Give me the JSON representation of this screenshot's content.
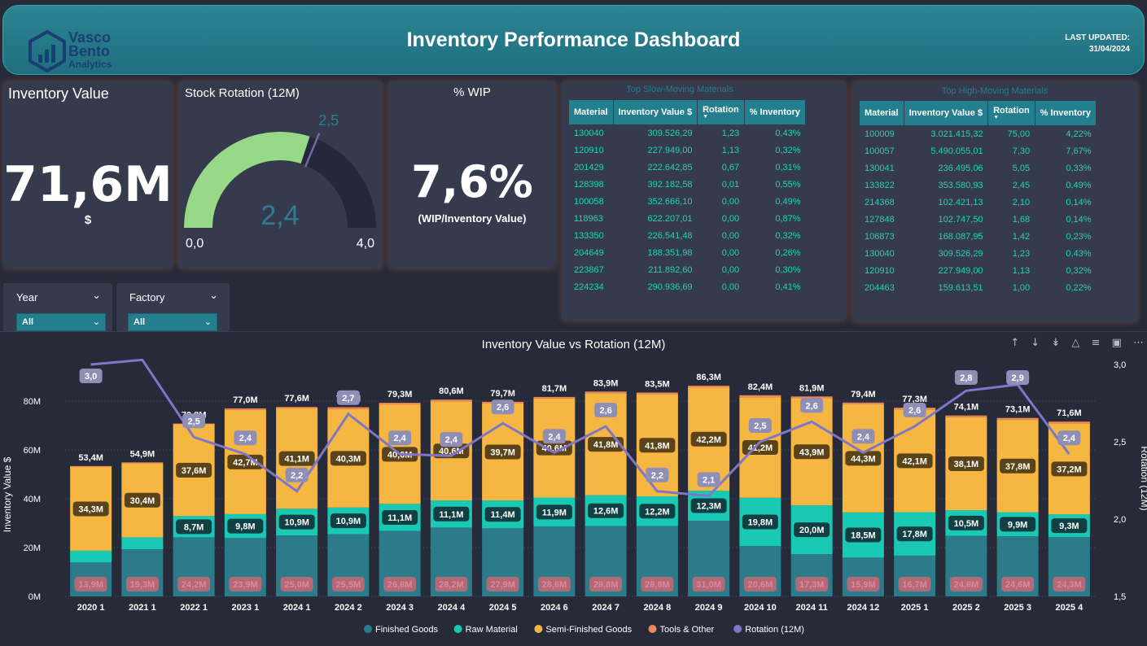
{
  "header": {
    "title": "Inventory Performance Dashboard",
    "logo_line1": "Vasco",
    "logo_line2": "Bento",
    "logo_line3": "Analytics",
    "updated_label": "LAST UPDATED:",
    "updated_date": "31/04/2024"
  },
  "kpi_value": {
    "title": "Inventory Value",
    "value": "71,6M",
    "unit": "$"
  },
  "kpi_rotation": {
    "title": "Stock Rotation (12M)",
    "value": "2,4",
    "min": "0,0",
    "max": "4,0",
    "target": "2,5",
    "value_num": 2.4,
    "min_num": 0,
    "max_num": 4,
    "target_num": 2.5
  },
  "kpi_wip": {
    "title": "% WIP",
    "value": "7,6%",
    "subtitle": "(WIP/Inventory Value)"
  },
  "slicers": {
    "year": {
      "label": "Year",
      "value": "All"
    },
    "factory": {
      "label": "Factory",
      "value": "All"
    }
  },
  "slow_table": {
    "caption": "Top Slow-Moving Materials",
    "headers": [
      "Material",
      "Inventory Value $",
      "Rotation",
      "% Inventory"
    ],
    "rows": [
      [
        "130040",
        "309.526,29",
        "1,23",
        "0,43%"
      ],
      [
        "120910",
        "227.949,00",
        "1,13",
        "0,32%"
      ],
      [
        "201429",
        "222.642,85",
        "0,67",
        "0,31%"
      ],
      [
        "128398",
        "392.182,58",
        "0,01",
        "0,55%"
      ],
      [
        "100058",
        "352.666,10",
        "0,00",
        "0,49%"
      ],
      [
        "118963",
        "622.207,01",
        "0,00",
        "0,87%"
      ],
      [
        "133350",
        "226.541,48",
        "0,00",
        "0,32%"
      ],
      [
        "204649",
        "188.351,98",
        "0,00",
        "0,26%"
      ],
      [
        "223867",
        "211.892,60",
        "0,00",
        "0,30%"
      ],
      [
        "224234",
        "290.936,69",
        "0,00",
        "0,41%"
      ]
    ]
  },
  "fast_table": {
    "caption": "Top High-Moving Materials",
    "headers": [
      "Material",
      "Inventory Value $",
      "Rotation",
      "% Inventory"
    ],
    "rows": [
      [
        "100009",
        "3.021.415,32",
        "75,00",
        "4,22%"
      ],
      [
        "100057",
        "5.490.055,01",
        "7,30",
        "7,67%"
      ],
      [
        "130041",
        "236.495,06",
        "5,05",
        "0,33%"
      ],
      [
        "133822",
        "353.580,93",
        "2,45",
        "0,49%"
      ],
      [
        "214368",
        "102.421,13",
        "2,10",
        "0,14%"
      ],
      [
        "127848",
        "102.747,50",
        "1,68",
        "0,14%"
      ],
      [
        "106873",
        "168.087,95",
        "1,42",
        "0,23%"
      ],
      [
        "130040",
        "309.526,29",
        "1,23",
        "0,43%"
      ],
      [
        "120910",
        "227.949,00",
        "1,13",
        "0,32%"
      ],
      [
        "204463",
        "159.613,51",
        "1,00",
        "0,22%"
      ]
    ]
  },
  "chart_data": {
    "type": "bar",
    "title": "Inventory Value vs Rotation (12M)",
    "ylabel": "Inventory Value $",
    "y2label": "Rotation (12M)",
    "ylim": [
      0,
      80
    ],
    "y_ticks": [
      "0M",
      "20M",
      "40M",
      "60M",
      "80M"
    ],
    "y2lim": [
      1.5,
      3.0
    ],
    "y2_ticks": [
      "1,5",
      "2,0",
      "2,5",
      "3,0"
    ],
    "categories": [
      "2020 1",
      "2021 1",
      "2022 1",
      "2023 1",
      "2024 1",
      "2024 2",
      "2024 3",
      "2024 4",
      "2024 5",
      "2024 6",
      "2024 7",
      "2024 8",
      "2024 9",
      "2024 10",
      "2024 11",
      "2024 12",
      "2025 1",
      "2025 2",
      "2025 3",
      "2025 4"
    ],
    "totals": [
      "53,4M",
      "54,9M",
      "70,8M",
      "77,0M",
      "77,6M",
      "77,5M",
      "79,3M",
      "80,6M",
      "79,7M",
      "81,7M",
      "83,9M",
      "83,5M",
      "86,3M",
      "82,4M",
      "81,9M",
      "79,4M",
      "77,3M",
      "74,1M",
      "73,1M",
      "71,6M"
    ],
    "series": [
      {
        "name": "Finished Goods",
        "color": "#2b7b8a",
        "values": [
          13.9,
          19.3,
          24.2,
          23.9,
          25.0,
          25.5,
          26.8,
          28.2,
          27.9,
          28.6,
          28.8,
          28.8,
          31.0,
          20.6,
          17.3,
          15.9,
          16.7,
          24.8,
          24.6,
          24.3
        ],
        "labels": [
          "13,9M",
          "19,3M",
          "24,2M",
          "23,9M",
          "25,0M",
          "25,5M",
          "26,8M",
          "28,2M",
          "27,9M",
          "28,6M",
          "28,8M",
          "28,8M",
          "31,0M",
          "20,6M",
          "17,3M",
          "15,9M",
          "16,7M",
          "24,8M",
          "24,6M",
          "24,3M"
        ]
      },
      {
        "name": "Raw Material",
        "color": "#19c9b3",
        "values": [
          4.8,
          4.9,
          8.7,
          9.8,
          10.9,
          10.9,
          11.1,
          11.1,
          11.4,
          11.9,
          12.6,
          12.2,
          12.3,
          19.8,
          20.0,
          18.5,
          17.8,
          10.5,
          9.9,
          9.3
        ],
        "labels": [
          "",
          "",
          "8,7M",
          "9,8M",
          "10,9M",
          "10,9M",
          "11,1M",
          "11,1M",
          "11,4M",
          "11,9M",
          "12,6M",
          "12,2M",
          "12,3M",
          "19,8M",
          "20,0M",
          "18,5M",
          "17,8M",
          "10,5M",
          "9,9M",
          "9,3M"
        ]
      },
      {
        "name": "Semi-Finished Goods",
        "color": "#f5b642",
        "values": [
          34.3,
          30.4,
          37.6,
          42.7,
          41.1,
          40.3,
          40.6,
          40.6,
          39.7,
          40.6,
          41.8,
          41.8,
          42.2,
          41.2,
          43.9,
          44.3,
          42.1,
          38.1,
          37.8,
          37.2
        ],
        "labels": [
          "34,3M",
          "30,4M",
          "37,6M",
          "42,7M",
          "41,1M",
          "40,3M",
          "40,6M",
          "40,6M",
          "39,7M",
          "40,6M",
          "41,8M",
          "41,8M",
          "42,2M",
          "41,2M",
          "43,9M",
          "44,3M",
          "42,1M",
          "38,1M",
          "37,8M",
          "37,2M"
        ]
      },
      {
        "name": "Tools & Other",
        "color": "#f0875a",
        "values": [
          0.4,
          0.3,
          0.3,
          0.6,
          0.6,
          0.8,
          0.8,
          0.7,
          0.7,
          0.6,
          0.7,
          0.7,
          0.8,
          0.8,
          0.7,
          0.7,
          0.7,
          0.7,
          0.8,
          0.8
        ],
        "labels": []
      },
      {
        "name": "Rotation (12M)",
        "color": "#7f76c8",
        "type": "line",
        "axis": "right",
        "values": [
          3.0,
          3.03,
          2.53,
          2.42,
          2.18,
          2.68,
          2.42,
          2.41,
          2.62,
          2.43,
          2.6,
          2.18,
          2.15,
          2.5,
          2.63,
          2.43,
          2.6,
          2.83,
          2.87,
          2.42
        ],
        "labels": [
          "3,0",
          "",
          "2,5",
          "2,4",
          "2,2",
          "2,7",
          "2,4",
          "2,4",
          "2,6",
          "2,4",
          "2,6",
          "2,2",
          "2,1",
          "2,5",
          "2,6",
          "2,4",
          "2,6",
          "2,8",
          "2,9",
          "2,4"
        ]
      }
    ],
    "legend_position": "bottom"
  }
}
